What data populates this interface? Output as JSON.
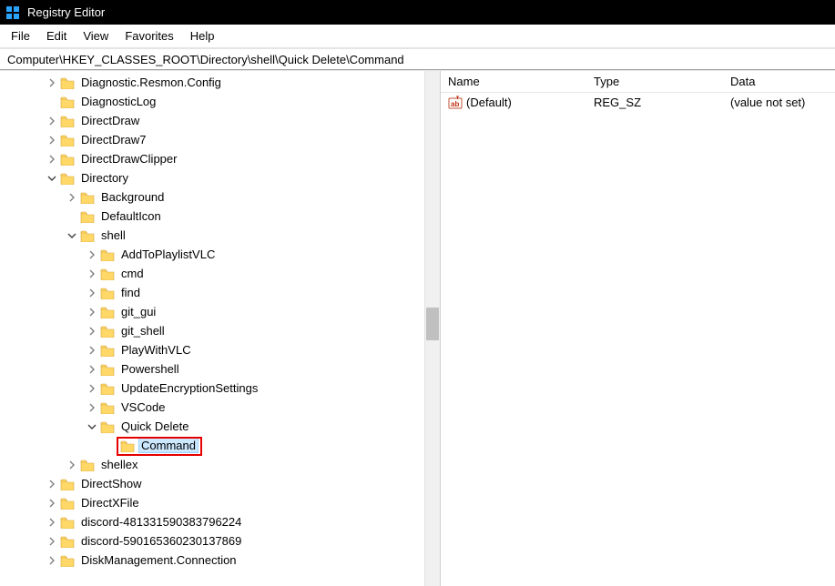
{
  "window": {
    "title": "Registry Editor",
    "address": "Computer\\HKEY_CLASSES_ROOT\\Directory\\shell\\Quick Delete\\Command"
  },
  "menubar": {
    "items": [
      "File",
      "Edit",
      "View",
      "Favorites",
      "Help"
    ]
  },
  "tree": {
    "rows": [
      {
        "indent": 2,
        "expander": "closed",
        "label": "Diagnostic.Resmon.Config"
      },
      {
        "indent": 2,
        "expander": "none",
        "label": "DiagnosticLog"
      },
      {
        "indent": 2,
        "expander": "closed",
        "label": "DirectDraw"
      },
      {
        "indent": 2,
        "expander": "closed",
        "label": "DirectDraw7"
      },
      {
        "indent": 2,
        "expander": "closed",
        "label": "DirectDrawClipper"
      },
      {
        "indent": 2,
        "expander": "open",
        "label": "Directory"
      },
      {
        "indent": 3,
        "expander": "closed",
        "label": "Background"
      },
      {
        "indent": 3,
        "expander": "none",
        "label": "DefaultIcon"
      },
      {
        "indent": 3,
        "expander": "open",
        "label": "shell"
      },
      {
        "indent": 4,
        "expander": "closed",
        "label": "AddToPlaylistVLC"
      },
      {
        "indent": 4,
        "expander": "closed",
        "label": "cmd"
      },
      {
        "indent": 4,
        "expander": "closed",
        "label": "find"
      },
      {
        "indent": 4,
        "expander": "closed",
        "label": "git_gui"
      },
      {
        "indent": 4,
        "expander": "closed",
        "label": "git_shell"
      },
      {
        "indent": 4,
        "expander": "closed",
        "label": "PlayWithVLC"
      },
      {
        "indent": 4,
        "expander": "closed",
        "label": "Powershell"
      },
      {
        "indent": 4,
        "expander": "closed",
        "label": "UpdateEncryptionSettings"
      },
      {
        "indent": 4,
        "expander": "closed",
        "label": "VSCode"
      },
      {
        "indent": 4,
        "expander": "open",
        "label": "Quick Delete"
      },
      {
        "indent": 5,
        "expander": "none",
        "label": "Command",
        "selected": true,
        "highlight": true
      },
      {
        "indent": 3,
        "expander": "closed",
        "label": "shellex"
      },
      {
        "indent": 2,
        "expander": "closed",
        "label": "DirectShow"
      },
      {
        "indent": 2,
        "expander": "closed",
        "label": "DirectXFile"
      },
      {
        "indent": 2,
        "expander": "closed",
        "label": "discord-481331590383796224"
      },
      {
        "indent": 2,
        "expander": "closed",
        "label": "discord-590165360230137869"
      },
      {
        "indent": 2,
        "expander": "closed",
        "label": "DiskManagement.Connection"
      }
    ]
  },
  "list": {
    "columns": {
      "name": "Name",
      "type": "Type",
      "data": "Data"
    },
    "rows": [
      {
        "name": "(Default)",
        "type": "REG_SZ",
        "data": "(value not set)"
      }
    ]
  },
  "icons": {
    "folder_fill": "#ffd867",
    "folder_stroke": "#d6a33a"
  }
}
